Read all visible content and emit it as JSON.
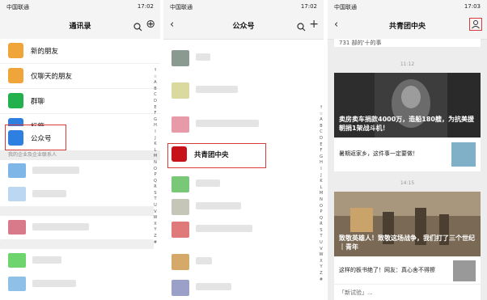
{
  "status": {
    "carrier": "中国联通",
    "time1": "17:02",
    "time2": "17:02",
    "time3": "17:03"
  },
  "panel1": {
    "title": "通讯录",
    "items": [
      {
        "label": "新的朋友",
        "color": "#f0a53a"
      },
      {
        "label": "仅聊天的朋友",
        "color": "#f0a53a"
      },
      {
        "label": "群聊",
        "color": "#22b14c"
      },
      {
        "label": "标签",
        "color": "#2f7fe0"
      },
      {
        "label": "公众号",
        "color": "#2f7fe0"
      }
    ],
    "section": "我的企业及企业联系人"
  },
  "panel2": {
    "title": "公众号",
    "highlighted": "共青团中央"
  },
  "panel3": {
    "title": "共青团中央",
    "top_snippet": "731 部的'十的事",
    "time_a": "11:12",
    "time_b": "14:15",
    "card1_headline": "卖房卖车捐款4000万，造船180艘，为抗美援朝捐1架战斗机！",
    "card1_sub": "暑期返家乡，这件事一定要做！",
    "card2_headline": "致敬英雄人！致敬这场战争，我们打了三个世纪｜青年",
    "card2_sub": "这样的板书绝了！网友：真心舍不得擦",
    "card2_sub2": "「新试验」..."
  },
  "index_letters": [
    "↑",
    "☆",
    "A",
    "B",
    "C",
    "D",
    "E",
    "F",
    "G",
    "H",
    "I",
    "J",
    "K",
    "L",
    "M",
    "N",
    "O",
    "P",
    "Q",
    "R",
    "S",
    "T",
    "U",
    "V",
    "W",
    "X",
    "Y",
    "Z",
    "#"
  ]
}
